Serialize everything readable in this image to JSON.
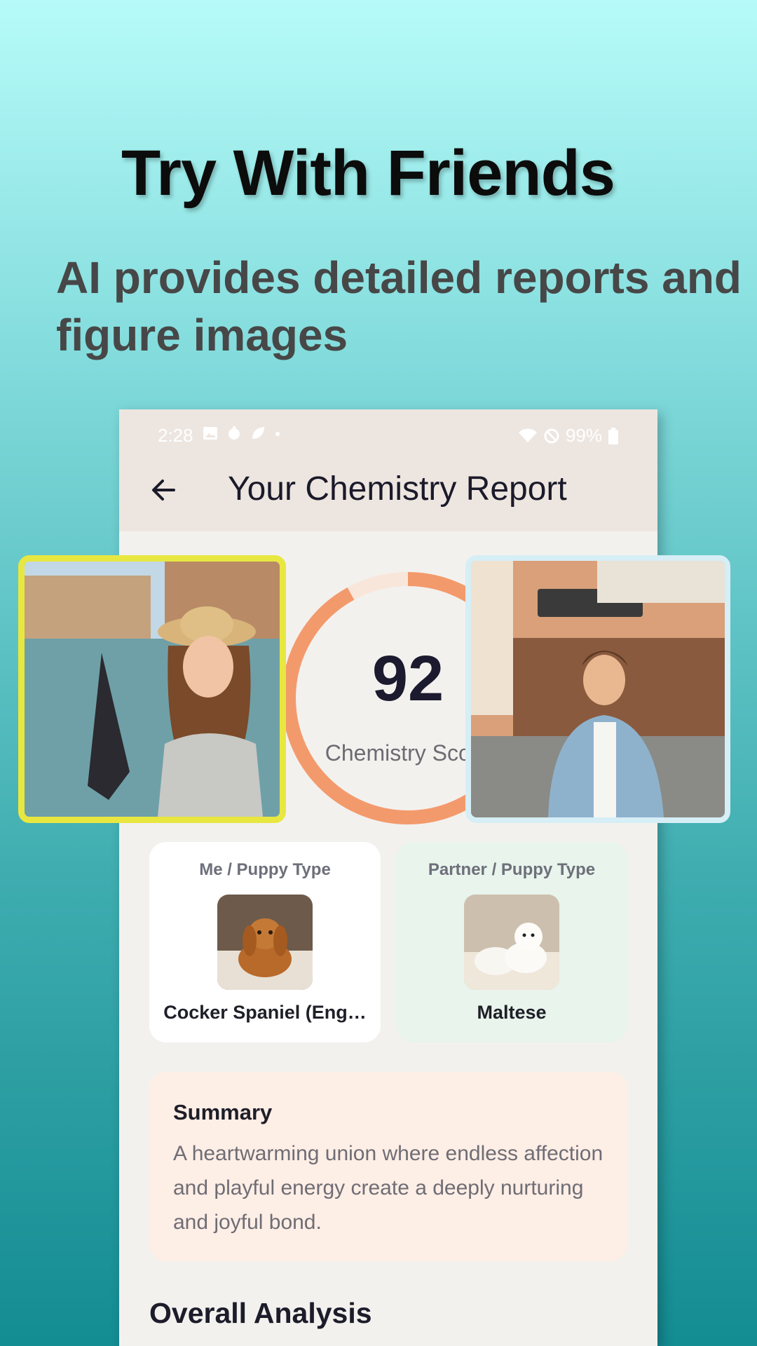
{
  "promo": {
    "headline": "Try With Friends",
    "subheadline": "AI provides detailed reports and figure images"
  },
  "status_bar": {
    "time": "2:28",
    "battery": "99%"
  },
  "app_bar": {
    "title": "Your Chemistry Report",
    "back_icon": "arrow-left-icon"
  },
  "score": {
    "value": "92",
    "label": "Chemistry Score",
    "fraction": 0.92
  },
  "photos": {
    "me": {
      "description": "woman in gondola"
    },
    "partner": {
      "description": "man at cafe"
    }
  },
  "types": {
    "me": {
      "label": "Me / Puppy Type",
      "name": "Cocker Spaniel (Eng…"
    },
    "partner": {
      "label": "Partner / Puppy Type",
      "name": "Maltese"
    }
  },
  "summary": {
    "title": "Summary",
    "text": "A heartwarming union where endless affection and playful energy create a deeply nurturing and joyful bond."
  },
  "section": {
    "overall_title": "Overall Analysis"
  },
  "colors": {
    "ring": "#f39a6c",
    "ring_track": "#f8e6da",
    "left_border": "#e8e740",
    "right_border": "#d6eef5"
  }
}
